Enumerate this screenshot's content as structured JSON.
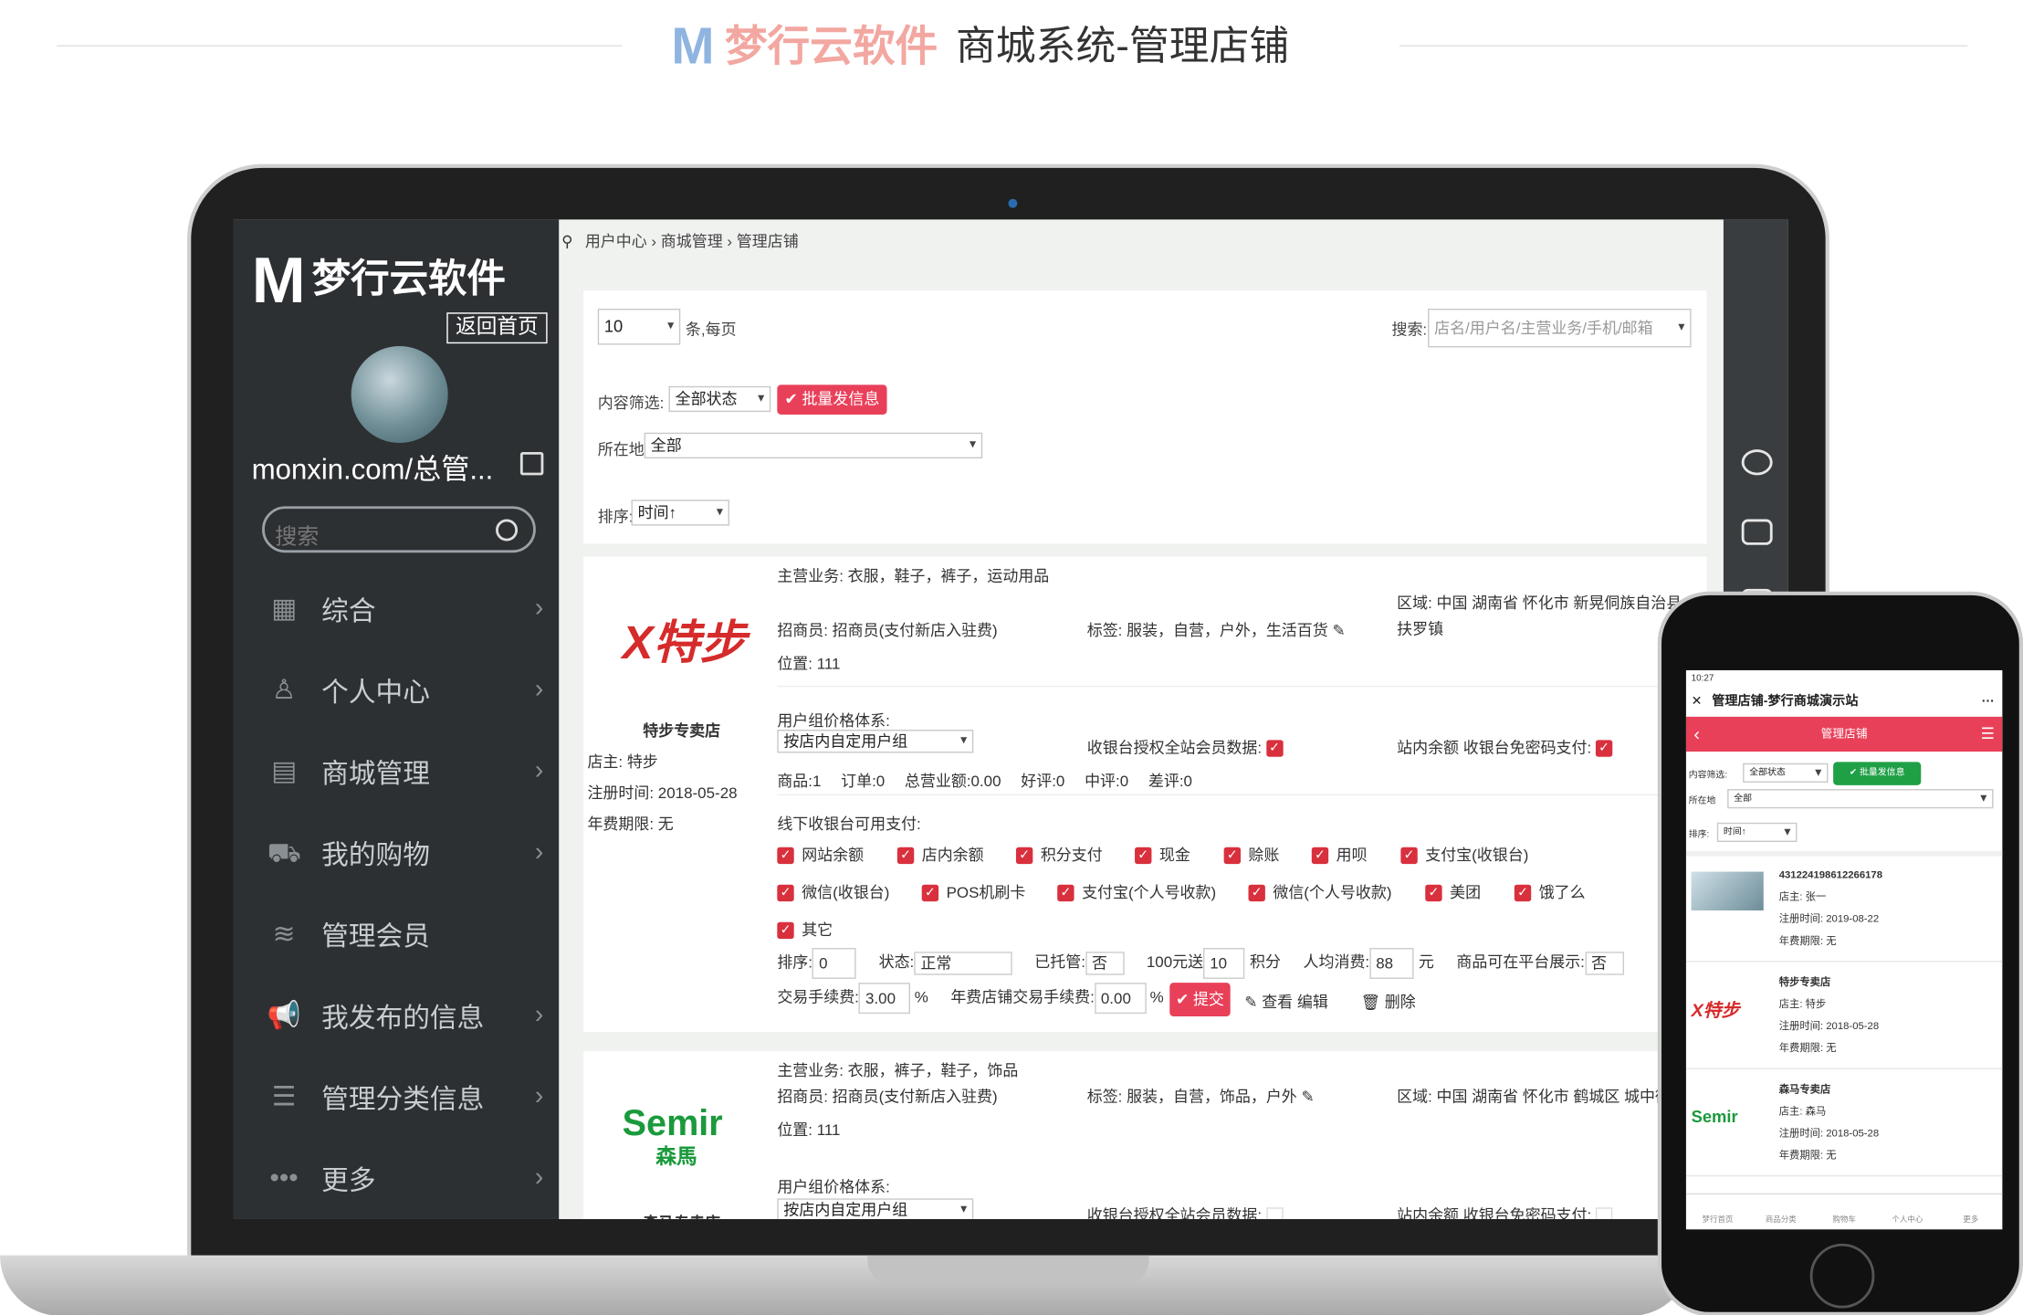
{
  "header": {
    "logo_mark": "M",
    "brand": "梦行云软件",
    "subtitle": "商城系统-管理店铺"
  },
  "sidebar": {
    "logo_mark": "M",
    "logo_text": "梦行云软件",
    "back_home": "返回首页",
    "username": "monxin.com/总管...",
    "search_placeholder": "搜索",
    "items": [
      {
        "label": "综合",
        "icon": "grid-icon"
      },
      {
        "label": "个人中心",
        "icon": "user-icon"
      },
      {
        "label": "商城管理",
        "icon": "store-icon"
      },
      {
        "label": "我的购物",
        "icon": "cart-icon"
      },
      {
        "label": "管理会员",
        "icon": "layers-icon"
      },
      {
        "label": "我发布的信息",
        "icon": "megaphone-icon"
      },
      {
        "label": "管理分类信息",
        "icon": "list-icon"
      },
      {
        "label": "更多",
        "icon": "more-icon"
      }
    ]
  },
  "breadcrumb": [
    "用户中心",
    "商城管理",
    "管理店铺"
  ],
  "filters": {
    "per_page": "10",
    "per_page_label": "条,每页",
    "search_label": "搜索:",
    "search_placeholder": "店名/用户名/主营业务/手机/邮箱",
    "content_filter_label": "内容筛选:",
    "content_filter_value": "全部状态",
    "batch_button": "批量发信息",
    "location_label": "所在地",
    "location_value": "全部",
    "sort_label": "排序:",
    "sort_value": "时间↑"
  },
  "stores": [
    {
      "logo_text": "X特步",
      "name": "特步专卖店",
      "owner": "店主: 特步",
      "reg_date": "注册时间: 2018-05-28",
      "annual": "年费期限: 无",
      "business": "主营业务: 衣服，鞋子，裤子，运动用品",
      "recruiter": "招商员: 招商员(支付新店入驻费)",
      "tags": "标签: 服装，自营，户外，生活百货",
      "region_line1": "区域: 中国 湖南省 怀化市 新晃侗族自治县",
      "region_line2": "扶罗镇",
      "position": "位置: 111",
      "price_system_label": "用户组价格体系:",
      "price_system_value": "按店内自定用户组",
      "cashier_auth_label": "收银台授权全站会员数据:",
      "balance_free_label": "站内余额 收银台免密码支付:",
      "stats": {
        "goods": "商品:1",
        "orders": "订单:0",
        "total_sales": "总营业额:0.00",
        "good": "好评:0",
        "mid": "中评:0",
        "bad": "差评:0"
      },
      "offline_label": "线下收银台可用支付:",
      "payments": [
        "网站余额",
        "店内余额",
        "积分支付",
        "现金",
        "赊账",
        "用呗",
        "支付宝(收银台)",
        "微信(收银台)",
        "POS机刷卡",
        "支付宝(个人号收款)",
        "微信(个人号收款)",
        "美团",
        "饿了么",
        "其它"
      ],
      "sort_label": "排序:",
      "sort_value": "0",
      "status_label": "状态:",
      "status_value": "正常",
      "hosted_label": "已托管:",
      "hosted_value": "否",
      "reward_label": "100元送",
      "reward_value": "10",
      "reward_unit": "积分",
      "avg_label": "人均消费:",
      "avg_value": "88",
      "avg_unit": "元",
      "platform_label": "商品可在平台展示:",
      "platform_value": "否",
      "fee_label": "交易手续费:",
      "fee_value": "3.00",
      "fee_unit": "%",
      "annual_fee_label": "年费店铺交易手续费:",
      "annual_fee_value": "0.00",
      "annual_fee_unit": "%",
      "submit": "提交",
      "view_edit": "查看 编辑",
      "delete": "删除"
    },
    {
      "logo_text": "Semir",
      "logo_sub": "森馬",
      "name": "森马专卖店",
      "business": "主营业务: 衣服，裤子，鞋子，饰品",
      "recruiter": "招商员: 招商员(支付新店入驻费)",
      "tags": "标签: 服装，自营，饰品，户外",
      "region_line1": "区域: 中国 湖南省 怀化市 鹤城区 城中街",
      "position": "位置: 111",
      "price_system_label": "用户组价格体系:",
      "price_system_value": "按店内自定用户组",
      "cashier_auth_label": "收银台授权全站会员数据:",
      "balance_free_label": "站内余额 收银台免密码支付:"
    }
  ],
  "phone": {
    "status": "10:27",
    "title": "管理店铺-梦行商城演示站",
    "more": "···",
    "red_title": "管理店铺",
    "content_filter_label": "内容筛选:",
    "content_filter_value": "全部状态",
    "batch_button": "批量发信息",
    "location_label": "所在地",
    "location_value": "全部",
    "sort_label": "排序:",
    "sort_value": "时间↑",
    "cards": [
      {
        "title": "431224198612266178",
        "owner": "店主: 张一",
        "reg": "注册时间: 2019-08-22",
        "annual": "年费期限: 无"
      },
      {
        "title": "特步专卖店",
        "owner": "店主: 特步",
        "reg": "注册时间: 2018-05-28",
        "annual": "年费期限: 无"
      },
      {
        "title": "森马专卖店",
        "owner": "店主: 森马",
        "reg": "注册时间: 2018-05-28",
        "annual": "年费期限: 无"
      }
    ],
    "nav": [
      "梦行首页",
      "商品分类",
      "购物车",
      "个人中心",
      "更多"
    ]
  },
  "colors": {
    "accent": "#e9405a",
    "sidebar": "#2d3033",
    "check": "#d9303e"
  }
}
